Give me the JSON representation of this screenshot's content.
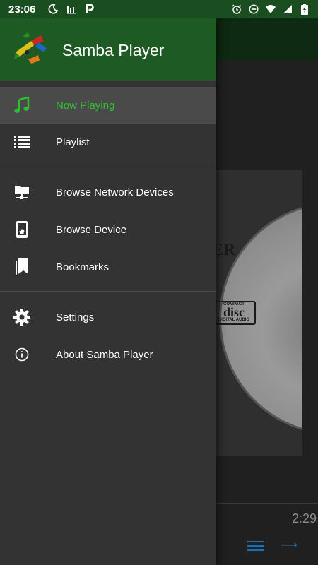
{
  "status_bar": {
    "time": "23:06",
    "left_icons": [
      "moon-icon",
      "chart-icon",
      "parking-icon"
    ],
    "right_icons": [
      "alarm-icon",
      "dnd-icon",
      "wifi-icon",
      "signal-icon",
      "battery-icon"
    ]
  },
  "drawer": {
    "app_title": "Samba Player",
    "items": [
      {
        "label": "Now Playing",
        "icon": "music-note-icon",
        "active": true
      },
      {
        "label": "Playlist",
        "icon": "list-icon",
        "active": false
      },
      {
        "label": "Browse Network Devices",
        "icon": "network-folder-icon",
        "active": false
      },
      {
        "label": "Browse Device",
        "icon": "phone-android-icon",
        "active": false
      },
      {
        "label": "Bookmarks",
        "icon": "bookmarks-icon",
        "active": false
      },
      {
        "label": "Settings",
        "icon": "gear-icon",
        "active": false
      },
      {
        "label": "About Samba Player",
        "icon": "info-icon",
        "active": false
      }
    ]
  },
  "background": {
    "cover_text": "ER",
    "disc_logo_top": "COMPACT",
    "disc_logo_main": "disc",
    "disc_logo_bottom": "DIGITAL AUDIO",
    "elapsed_time": "2:29"
  },
  "colors": {
    "accent": "#2fc032",
    "header": "#1e5a23",
    "status_bar": "#1a4d1f",
    "drawer_bg": "#333333",
    "control_blue": "#1f6fb0"
  }
}
